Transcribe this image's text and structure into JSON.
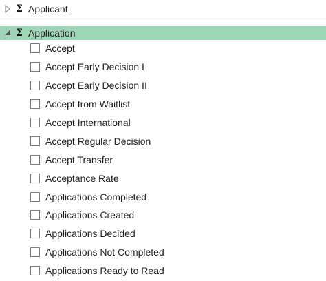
{
  "tree": {
    "groups": [
      {
        "label": "Applicant",
        "expanded": false,
        "selected": false,
        "toggle_icon": "triangle-right-outline-icon",
        "type_icon": "sigma-icon"
      },
      {
        "label": "Application",
        "expanded": true,
        "selected": true,
        "toggle_icon": "triangle-down-filled-icon",
        "type_icon": "sigma-icon",
        "items": [
          {
            "label": "Accept",
            "checked": false
          },
          {
            "label": "Accept Early Decision I",
            "checked": false
          },
          {
            "label": "Accept Early Decision II",
            "checked": false
          },
          {
            "label": "Accept from Waitlist",
            "checked": false
          },
          {
            "label": "Accept International",
            "checked": false
          },
          {
            "label": "Accept Regular Decision",
            "checked": false
          },
          {
            "label": "Accept Transfer",
            "checked": false
          },
          {
            "label": "Acceptance Rate",
            "checked": false
          },
          {
            "label": "Applications Completed",
            "checked": false
          },
          {
            "label": "Applications Created",
            "checked": false
          },
          {
            "label": "Applications Decided",
            "checked": false
          },
          {
            "label": "Applications Not Completed",
            "checked": false
          },
          {
            "label": "Applications Ready to Read",
            "checked": false
          }
        ]
      }
    ],
    "sigma_glyph": "Σ",
    "colors": {
      "selected_row": "#9fd5b7",
      "checkbox_border": "#7a7a7a",
      "text": "#222222"
    }
  }
}
